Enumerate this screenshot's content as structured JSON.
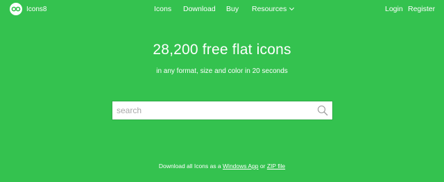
{
  "brand": {
    "name": "Icons8",
    "logo_icon": "icons8-logo-icon"
  },
  "nav": {
    "icons": "Icons",
    "download": "Download",
    "buy": "Buy",
    "resources": "Resources",
    "login": "Login",
    "register": "Register"
  },
  "hero": {
    "title": "28,200 free flat icons",
    "subtitle": "in any format, size and color in 20 seconds"
  },
  "search": {
    "placeholder": "search",
    "icon": "search-icon"
  },
  "footer": {
    "prefix": "Download all Icons as a ",
    "windows_app": "Windows App",
    "middle": " or ",
    "zip_file": "ZIP file"
  },
  "colors": {
    "background": "#34c24f",
    "text": "#ffffff",
    "search_bg": "#ffffff",
    "placeholder": "#a8a8a8"
  }
}
